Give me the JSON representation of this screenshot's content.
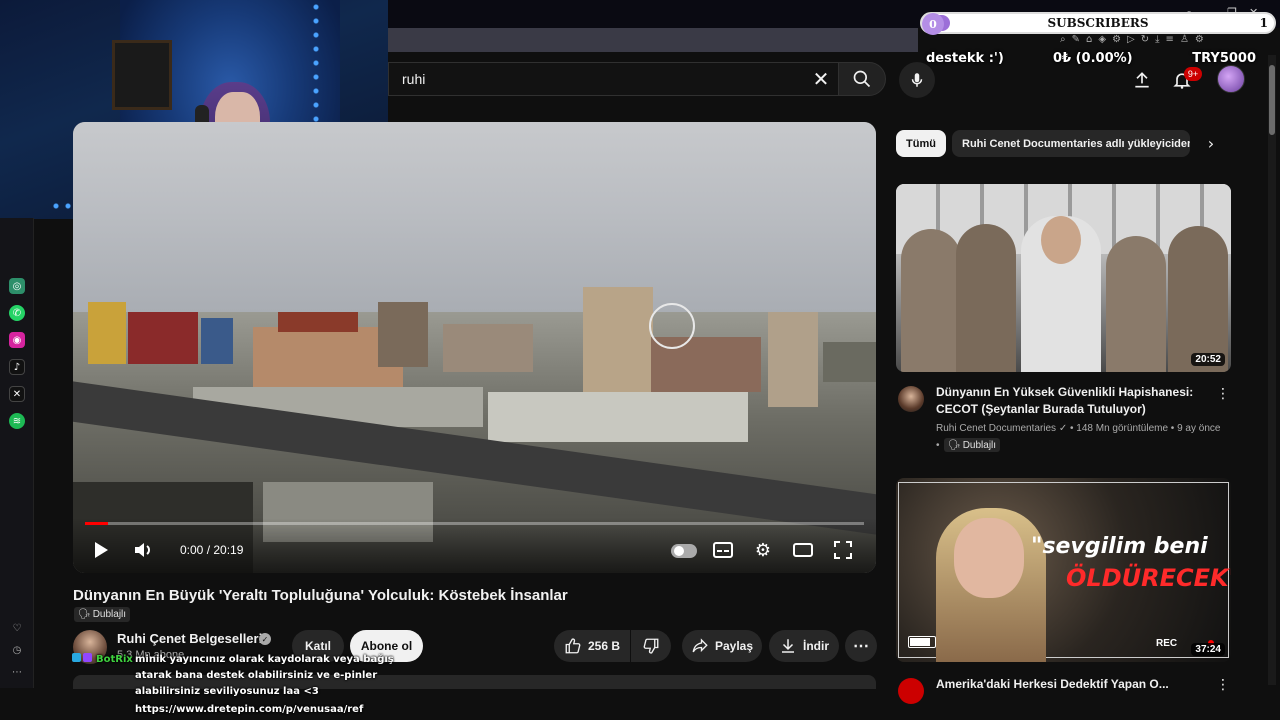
{
  "overlay": {
    "subscribers_label": "SUBSCRIBERS",
    "subscribers_current": "0",
    "subscribers_goal": "1",
    "donate_label": "destekk :')",
    "donate_amount": "0₺ (0.00%)",
    "donate_goal": "TRY5000"
  },
  "search": {
    "query": "ruhi",
    "clear_icon": "close-icon",
    "search_icon": "search-icon",
    "mic_icon": "mic-icon"
  },
  "header": {
    "upload_icon": "upload-icon",
    "bell_icon": "bell-icon",
    "notifications_badge": "9+"
  },
  "player": {
    "time": "0:00 / 20:19",
    "progress_fraction": 0.03
  },
  "video": {
    "title": "Dünyanın En Büyük 'Yeraltı Topluluğuna' Yolculuk: Köstebek İnsanlar",
    "dub_label": "Dublajlı",
    "channel_name": "Ruhi Çenet Belgeselleri",
    "channel_subs": "5,3 Mn abone",
    "join_label": "Katıl",
    "subscribe_label": "Abone ol",
    "likes": "256 B",
    "share_label": "Paylaş",
    "download_label": "İndir"
  },
  "chat": {
    "user": "BotRix",
    "lines": [
      "minik yayıncınız olarak kaydolarak veya bağış",
      "atarak bana destek olabilirsiniz ve e-pinler",
      "alabilirsiniz seviliyosunuz laa <3",
      "https://www.dretepin.com/p/venusaa/ref"
    ]
  },
  "chips": {
    "all": "Tümü",
    "uploads": "Ruhi Cenet Documentaries adlı yükleyiciden"
  },
  "recommendations": [
    {
      "title": "Dünyanın En Yüksek Güvenlikli Hapishanesi: CECOT (Şeytanlar Burada Tutuluyor)",
      "channel": "Ruhi Cenet Documentaries",
      "meta": "148 Mn görüntüleme • 9 ay önce",
      "dub_label": "Dublajlı",
      "duration": "20:52"
    },
    {
      "title": "Amerika'daki Herkesi Dedektif Yapan O...",
      "overlay_text_1": "\"sevgilim beni",
      "overlay_text_2": "ÖLDÜRECEK\"",
      "rec_label": "REC",
      "duration": "37:24"
    }
  ],
  "colors": {
    "accent_red": "#ff0000",
    "background": "#0f0f0f",
    "subscribers_purple": "#9c6fd8",
    "chat_green": "#3fd13f"
  }
}
